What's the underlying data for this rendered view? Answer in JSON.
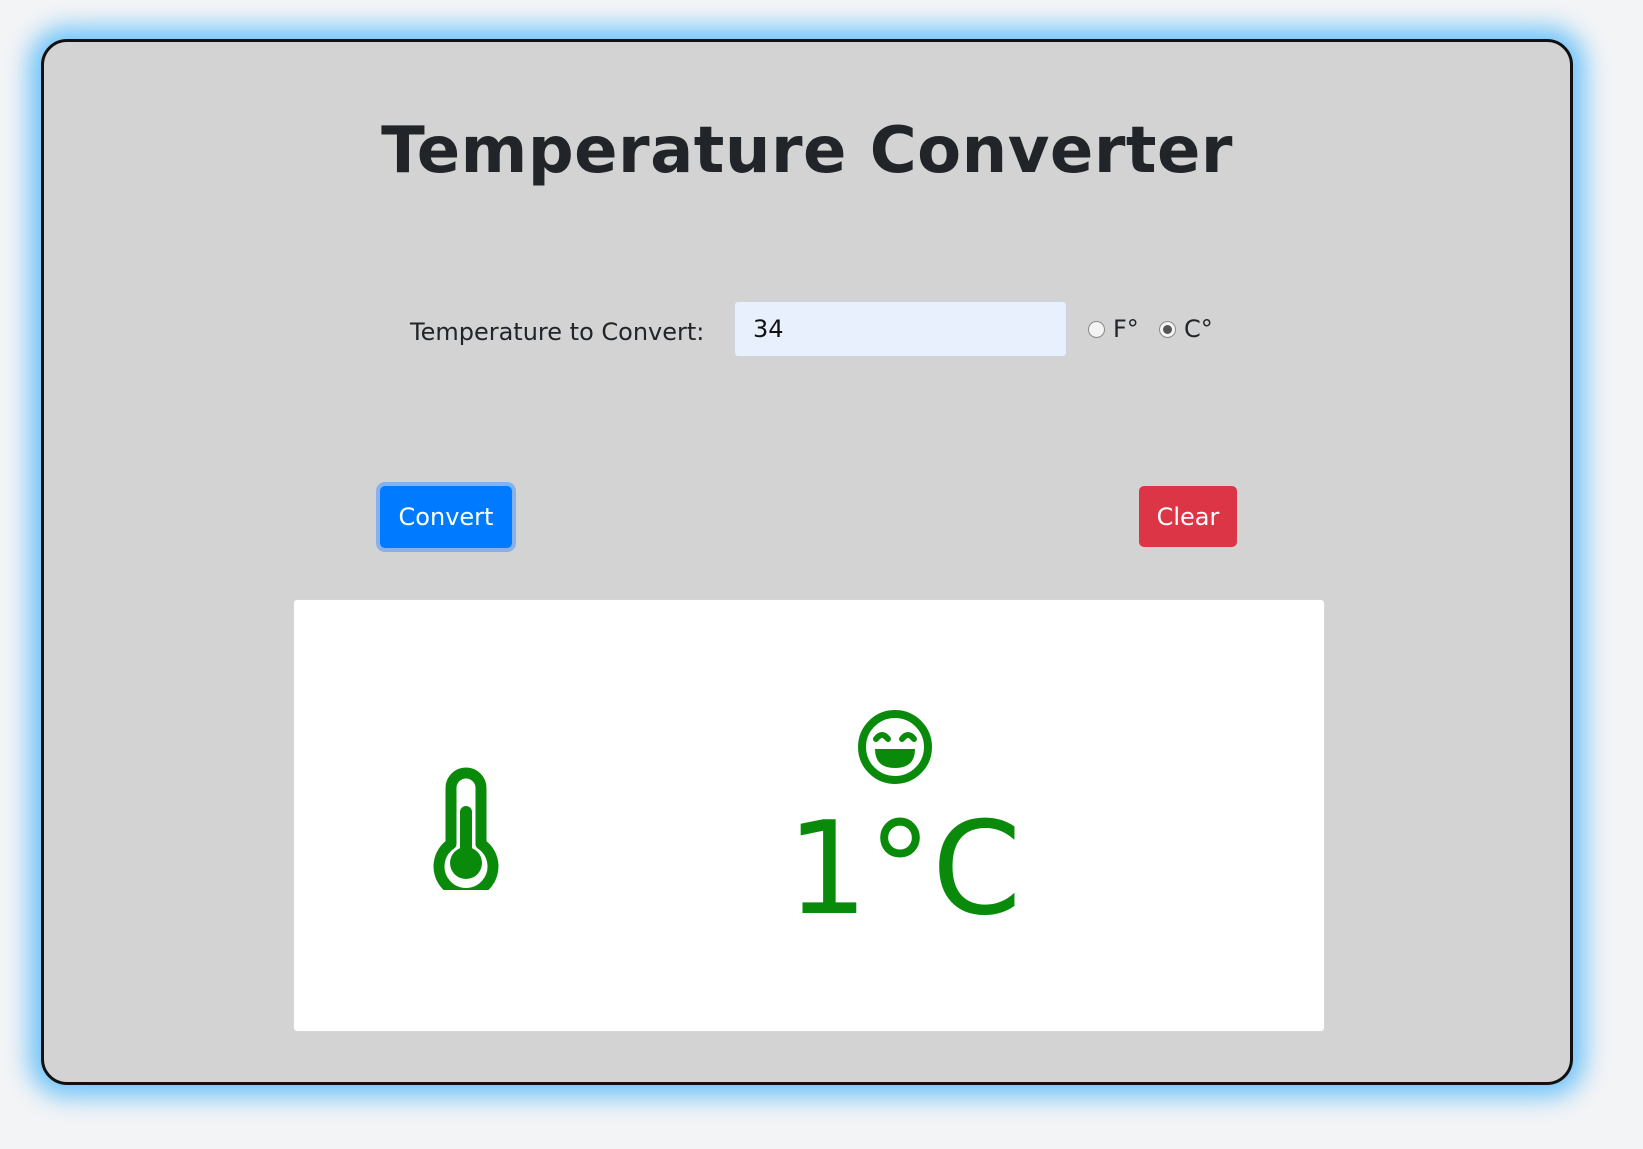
{
  "app": {
    "title": "Temperature Converter"
  },
  "form": {
    "label": "Temperature to Convert:",
    "input_value": "34",
    "units": [
      {
        "label": "F°",
        "checked": false
      },
      {
        "label": "C°",
        "checked": true
      }
    ]
  },
  "actions": {
    "convert_label": "Convert",
    "clear_label": "Clear"
  },
  "result": {
    "value": "1°C",
    "icons": [
      "thermometer-icon",
      "grinning-face-icon"
    ],
    "color": "#0a8a0a"
  },
  "colors": {
    "card_background": "#d3d3d3",
    "glow": "#46b4fa",
    "convert_button": "#007bff",
    "clear_button": "#dc3545",
    "input_background": "#e8f0fe"
  }
}
